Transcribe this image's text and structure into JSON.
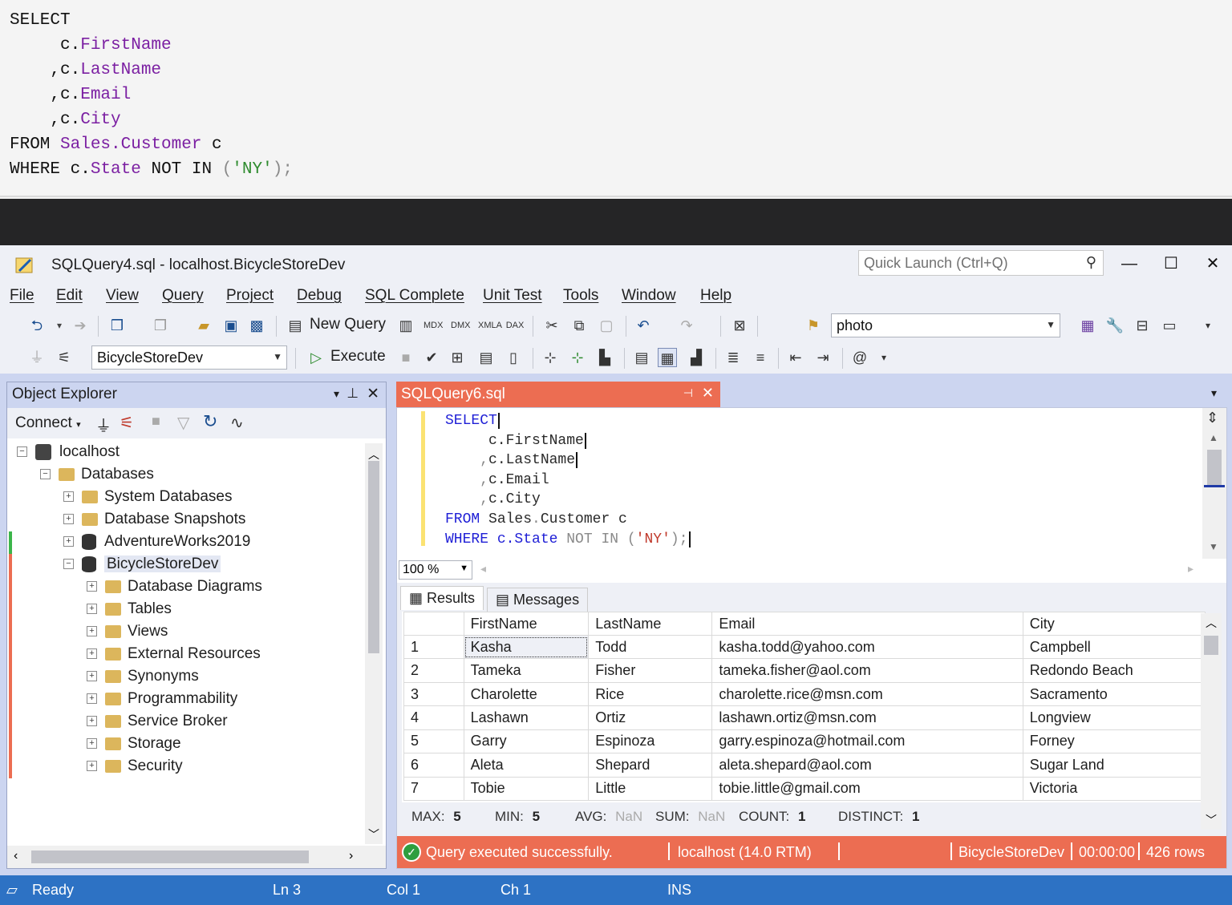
{
  "top_code": {
    "lines": [
      [
        {
          "t": "SELECT",
          "c": "kw-b"
        }
      ],
      [
        {
          "t": "     c.",
          "c": "kw-b"
        },
        {
          "t": "FirstName",
          "c": "kw-p"
        }
      ],
      [
        {
          "t": "    ,c.",
          "c": "kw-b"
        },
        {
          "t": "LastName",
          "c": "kw-p"
        }
      ],
      [
        {
          "t": "    ,c.",
          "c": "kw-b"
        },
        {
          "t": "Email",
          "c": "kw-p"
        }
      ],
      [
        {
          "t": "    ,c.",
          "c": "kw-b"
        },
        {
          "t": "City",
          "c": "kw-p"
        }
      ],
      [
        {
          "t": "FROM ",
          "c": "kw-b"
        },
        {
          "t": "Sales.Customer",
          "c": "kw-p"
        },
        {
          "t": " c",
          "c": "kw-b"
        }
      ],
      [
        {
          "t": "WHERE ",
          "c": "kw-b"
        },
        {
          "t": "c.",
          "c": "kw-b"
        },
        {
          "t": "State",
          "c": "kw-p"
        },
        {
          "t": " NOT IN ",
          "c": "kw-b"
        },
        {
          "t": "(",
          "c": "kw-g"
        },
        {
          "t": "'NY'",
          "c": "kw-s"
        },
        {
          "t": ");",
          "c": "kw-g"
        }
      ]
    ]
  },
  "window": {
    "title": "SQLQuery4.sql - localhost.BicycleStoreDev",
    "quick_launch_placeholder": "Quick Launch (Ctrl+Q)",
    "minimize": "—",
    "maximize": "☐",
    "close": "✕"
  },
  "menu": [
    "File",
    "Edit",
    "View",
    "Query",
    "Project",
    "Debug",
    "SQL Complete",
    "Unit Test",
    "Tools",
    "Window",
    "Help"
  ],
  "toolbar": {
    "new_query": "New Query",
    "search_combo_value": "photo",
    "database_combo_value": "BicycleStoreDev",
    "execute": "Execute"
  },
  "object_explorer": {
    "title": "Object Explorer",
    "connect": "Connect",
    "tree": [
      {
        "label": "localhost",
        "indent": 0,
        "icon": "server",
        "exp": "⊟"
      },
      {
        "label": "Databases",
        "indent": 1,
        "icon": "folder",
        "exp": "⊟"
      },
      {
        "label": "System Databases",
        "indent": 2,
        "icon": "folder",
        "exp": "⊞"
      },
      {
        "label": "Database Snapshots",
        "indent": 2,
        "icon": "folder",
        "exp": "⊞"
      },
      {
        "label": "AdventureWorks2019",
        "indent": 2,
        "icon": "db",
        "exp": "⊞"
      },
      {
        "label": "BicycleStoreDev",
        "indent": 2,
        "icon": "db",
        "exp": "⊟"
      },
      {
        "label": "Database Diagrams",
        "indent": 3,
        "icon": "folder",
        "exp": "⊞"
      },
      {
        "label": "Tables",
        "indent": 3,
        "icon": "folder",
        "exp": "⊞"
      },
      {
        "label": "Views",
        "indent": 3,
        "icon": "folder",
        "exp": "⊞"
      },
      {
        "label": "External Resources",
        "indent": 3,
        "icon": "folder",
        "exp": "⊞"
      },
      {
        "label": "Synonyms",
        "indent": 3,
        "icon": "folder",
        "exp": "⊞"
      },
      {
        "label": "Programmability",
        "indent": 3,
        "icon": "folder",
        "exp": "⊞"
      },
      {
        "label": "Service Broker",
        "indent": 3,
        "icon": "folder",
        "exp": "⊞"
      },
      {
        "label": "Storage",
        "indent": 3,
        "icon": "folder",
        "exp": "⊞"
      },
      {
        "label": "Security",
        "indent": 3,
        "icon": "folder",
        "exp": "⊞"
      }
    ]
  },
  "editor": {
    "tab_title": "SQLQuery6.sql",
    "code_lines": [
      [
        {
          "t": "SELECT",
          "c": "cb"
        }
      ],
      [
        {
          "t": "     c.",
          "c": "cs"
        },
        {
          "t": "FirstName",
          "c": "cs"
        }
      ],
      [
        {
          "t": "    ,",
          "c": "cg"
        },
        {
          "t": "c.",
          "c": "cs"
        },
        {
          "t": "LastName",
          "c": "cs"
        }
      ],
      [
        {
          "t": "    ,",
          "c": "cg"
        },
        {
          "t": "c.",
          "c": "cs"
        },
        {
          "t": "Email",
          "c": "cs"
        }
      ],
      [
        {
          "t": "    ,",
          "c": "cg"
        },
        {
          "t": "c.",
          "c": "cs"
        },
        {
          "t": "City",
          "c": "cs"
        }
      ],
      [
        {
          "t": "FROM ",
          "c": "cb"
        },
        {
          "t": "Sales",
          "c": "cs"
        },
        {
          "t": ".",
          "c": "cg"
        },
        {
          "t": "Customer c",
          "c": "cs"
        }
      ],
      [
        {
          "t": "WHERE ",
          "c": "cb"
        },
        {
          "t": "c.",
          "c": "cb"
        },
        {
          "t": "State",
          "c": "cb"
        },
        {
          "t": " NOT IN ",
          "c": "cg"
        },
        {
          "t": "(",
          "c": "cg"
        },
        {
          "t": "'NY'",
          "c": "cr"
        },
        {
          "t": ");",
          "c": "cg"
        }
      ]
    ],
    "zoom": "100 %"
  },
  "results": {
    "tab_results": "Results",
    "tab_messages": "Messages",
    "columns": [
      "",
      "FirstName",
      "LastName",
      "Email",
      "City"
    ],
    "rows": [
      [
        "1",
        "Kasha",
        "Todd",
        "kasha.todd@yahoo.com",
        "Campbell"
      ],
      [
        "2",
        "Tameka",
        "Fisher",
        "tameka.fisher@aol.com",
        "Redondo Beach"
      ],
      [
        "3",
        "Charolette",
        "Rice",
        "charolette.rice@msn.com",
        "Sacramento"
      ],
      [
        "4",
        "Lashawn",
        "Ortiz",
        "lashawn.ortiz@msn.com",
        "Longview"
      ],
      [
        "5",
        "Garry",
        "Espinoza",
        "garry.espinoza@hotmail.com",
        "Forney"
      ],
      [
        "6",
        "Aleta",
        "Shepard",
        "aleta.shepard@aol.com",
        "Sugar Land"
      ],
      [
        "7",
        "Tobie",
        "Little",
        "tobie.little@gmail.com",
        "Victoria"
      ]
    ],
    "agg": [
      {
        "label": "MAX:",
        "value": "5"
      },
      {
        "label": "MIN:",
        "value": "5"
      },
      {
        "label": "AVG:",
        "value": "NaN"
      },
      {
        "label": "SUM:",
        "value": "NaN"
      },
      {
        "label": "COUNT:",
        "value": "1"
      },
      {
        "label": "DISTINCT:",
        "value": "1"
      }
    ]
  },
  "query_status": {
    "message": "Query executed successfully.",
    "server": "localhost (14.0 RTM)",
    "database": "BicycleStoreDev",
    "elapsed": "00:00:00",
    "rows": "426 rows"
  },
  "app_status": {
    "ready": "Ready",
    "ln": "Ln 3",
    "col": "Col 1",
    "ch": "Ch 1",
    "mode": "INS"
  },
  "colors": {
    "accent": "#ec6d52",
    "status_blue": "#2d72c4",
    "frame": "#ccd5f0"
  }
}
